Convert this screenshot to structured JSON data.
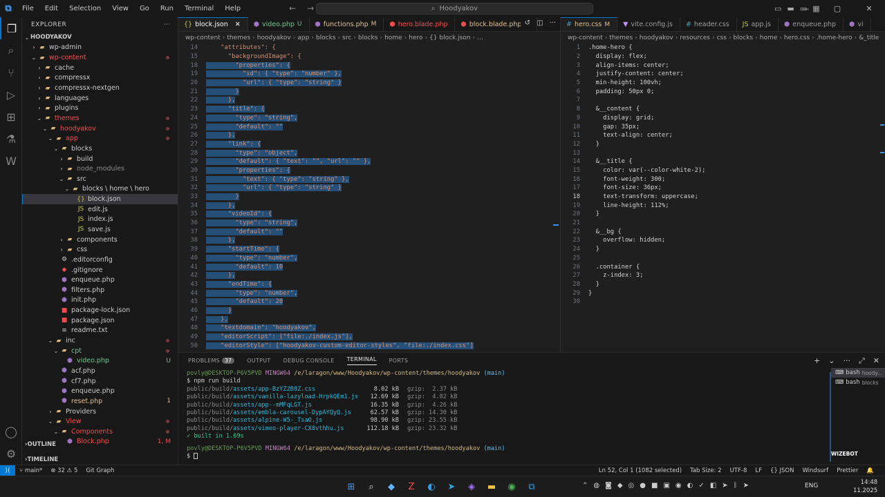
{
  "titlebar": {
    "menu": [
      "File",
      "Edit",
      "Selection",
      "View",
      "Go",
      "Run",
      "Terminal",
      "Help"
    ],
    "search": "Hoodyakov"
  },
  "sidebar": {
    "title": "EXPLORER",
    "root": "HOODYAKOV",
    "items": [
      {
        "label": "wp-admin",
        "depth": 1,
        "kind": "folder",
        "open": false,
        "color": ""
      },
      {
        "label": "wp-content",
        "depth": 1,
        "kind": "folder",
        "open": true,
        "color": "red",
        "dot": true
      },
      {
        "label": "cache",
        "depth": 2,
        "kind": "folder",
        "open": false,
        "color": ""
      },
      {
        "label": "compressx",
        "depth": 2,
        "kind": "folder",
        "open": false,
        "color": ""
      },
      {
        "label": "compressx-nextgen",
        "depth": 2,
        "kind": "folder",
        "open": false,
        "color": ""
      },
      {
        "label": "languages",
        "depth": 2,
        "kind": "folder",
        "open": false,
        "color": ""
      },
      {
        "label": "plugins",
        "depth": 2,
        "kind": "folder",
        "open": false,
        "color": ""
      },
      {
        "label": "themes",
        "depth": 2,
        "kind": "folder",
        "open": true,
        "color": "red",
        "dot": true
      },
      {
        "label": "hoodyakov",
        "depth": 3,
        "kind": "folder",
        "open": true,
        "color": "red",
        "dot": true
      },
      {
        "label": "app",
        "depth": 4,
        "kind": "folder",
        "open": true,
        "color": "red",
        "dot": true
      },
      {
        "label": "blocks",
        "depth": 5,
        "kind": "folder",
        "open": true,
        "color": "",
        "dot": false
      },
      {
        "label": "build",
        "depth": 6,
        "kind": "folder",
        "open": false,
        "color": ""
      },
      {
        "label": "node_modules",
        "depth": 6,
        "kind": "folder",
        "open": false,
        "color": "dim"
      },
      {
        "label": "src",
        "depth": 6,
        "kind": "folder",
        "open": true,
        "color": ""
      },
      {
        "label": "blocks \\ home \\ hero",
        "depth": 7,
        "kind": "folder",
        "open": true,
        "color": ""
      },
      {
        "label": "block.json",
        "depth": 8,
        "kind": "json",
        "color": "",
        "selected": true
      },
      {
        "label": "edit.js",
        "depth": 8,
        "kind": "js",
        "color": ""
      },
      {
        "label": "index.js",
        "depth": 8,
        "kind": "js",
        "color": ""
      },
      {
        "label": "save.js",
        "depth": 8,
        "kind": "js",
        "color": ""
      },
      {
        "label": "components",
        "depth": 6,
        "kind": "folder",
        "open": false,
        "color": ""
      },
      {
        "label": "css",
        "depth": 6,
        "kind": "folder",
        "open": false,
        "color": ""
      },
      {
        "label": ".editorconfig",
        "depth": 5,
        "kind": "cfg",
        "color": ""
      },
      {
        "label": ".gitignore",
        "depth": 5,
        "kind": "git",
        "color": ""
      },
      {
        "label": "enqueue.php",
        "depth": 5,
        "kind": "php",
        "color": ""
      },
      {
        "label": "filters.php",
        "depth": 5,
        "kind": "php",
        "color": ""
      },
      {
        "label": "init.php",
        "depth": 5,
        "kind": "php",
        "color": ""
      },
      {
        "label": "package-lock.json",
        "depth": 5,
        "kind": "npm",
        "color": ""
      },
      {
        "label": "package.json",
        "depth": 5,
        "kind": "npm",
        "color": ""
      },
      {
        "label": "readme.txt",
        "depth": 5,
        "kind": "txt",
        "color": ""
      },
      {
        "label": "inc",
        "depth": 4,
        "kind": "folder",
        "open": true,
        "color": "",
        "dot": true
      },
      {
        "label": "cpt",
        "depth": 5,
        "kind": "folder",
        "open": true,
        "color": "green",
        "dot": true
      },
      {
        "label": "video.php",
        "depth": 6,
        "kind": "php",
        "color": "green",
        "badge": "U"
      },
      {
        "label": "acf.php",
        "depth": 5,
        "kind": "php",
        "color": ""
      },
      {
        "label": "cf7.php",
        "depth": 5,
        "kind": "php",
        "color": ""
      },
      {
        "label": "enqueue.php",
        "depth": 5,
        "kind": "php",
        "color": ""
      },
      {
        "label": "reset.php",
        "depth": 5,
        "kind": "php",
        "color": "orange",
        "badge": "1"
      },
      {
        "label": "Providers",
        "depth": 4,
        "kind": "folder",
        "open": false,
        "color": ""
      },
      {
        "label": "View",
        "depth": 4,
        "kind": "folder",
        "open": true,
        "color": "red",
        "dot": true
      },
      {
        "label": "Components",
        "depth": 5,
        "kind": "folder",
        "open": true,
        "color": "red",
        "dot": true
      },
      {
        "label": "Block.php",
        "depth": 6,
        "kind": "php",
        "color": "red",
        "badge": "1, M"
      }
    ],
    "outline": "OUTLINE",
    "timeline": "TIMELINE"
  },
  "left_editor": {
    "tabs": [
      {
        "label": "block.json",
        "status": "",
        "active": true
      },
      {
        "label": "video.php",
        "status": "U",
        "active": false
      },
      {
        "label": "functions.php",
        "status": "M",
        "active": false
      },
      {
        "label": "hero.blade.php",
        "status": "",
        "active": false
      },
      {
        "label": "block.blade.php",
        "status": "M",
        "active": false
      }
    ],
    "breadcrumb": [
      "wp-content",
      "themes",
      "hoodyakov",
      "app",
      "blocks",
      "src",
      "blocks",
      "home",
      "hero",
      "{} block.json",
      "..."
    ],
    "lines": [
      {
        "n": "14",
        "t": "    \"attributes\": {"
      },
      {
        "n": "15",
        "t": "      \"backgroundImage\": {"
      },
      {
        "n": "18",
        "t": "        \"properties\": {"
      },
      {
        "n": "19",
        "t": "          \"id\": { \"type\": \"number\" },"
      },
      {
        "n": "20",
        "t": "          \"url\": { \"type\": \"string\" }"
      },
      {
        "n": "21",
        "t": "        }"
      },
      {
        "n": "22",
        "t": "      },"
      },
      {
        "n": "23",
        "t": "      \"title\": {"
      },
      {
        "n": "24",
        "t": "        \"type\": \"string\","
      },
      {
        "n": "25",
        "t": "        \"default\": \"\""
      },
      {
        "n": "26",
        "t": "      },"
      },
      {
        "n": "27",
        "t": "      \"link\": {"
      },
      {
        "n": "28",
        "t": "        \"type\": \"object\","
      },
      {
        "n": "29",
        "t": "        \"default\": { \"text\": \"\", \"url\": \"\" },"
      },
      {
        "n": "30",
        "t": "        \"properties\": {"
      },
      {
        "n": "31",
        "t": "          \"text\": { \"type\": \"string\" },"
      },
      {
        "n": "32",
        "t": "          \"url\": { \"type\": \"string\" }"
      },
      {
        "n": "33",
        "t": "        }"
      },
      {
        "n": "34",
        "t": "      },"
      },
      {
        "n": "35",
        "t": "      \"videoId\": {"
      },
      {
        "n": "36",
        "t": "        \"type\": \"string\","
      },
      {
        "n": "37",
        "t": "        \"default\": \"\""
      },
      {
        "n": "38",
        "t": "      },"
      },
      {
        "n": "39",
        "t": "      \"startTime\": {"
      },
      {
        "n": "40",
        "t": "        \"type\": \"number\","
      },
      {
        "n": "41",
        "t": "        \"default\": 10"
      },
      {
        "n": "42",
        "t": "      },"
      },
      {
        "n": "43",
        "t": "      \"endTime\": {"
      },
      {
        "n": "44",
        "t": "        \"type\": \"number\","
      },
      {
        "n": "45",
        "t": "        \"default\": 20"
      },
      {
        "n": "46",
        "t": "      }"
      },
      {
        "n": "47",
        "t": "    },"
      },
      {
        "n": "48",
        "t": "    \"textdomain\": \"hoodyakov\","
      },
      {
        "n": "49",
        "t": "    \"editorScript\": [\"file:./index.js\"],"
      },
      {
        "n": "50",
        "t": "    \"editorStyle\": [\"hoodyakov-custom-editor-styles\", \"file:./index.css\"]"
      }
    ]
  },
  "right_editor": {
    "tabs": [
      {
        "label": "hero.css",
        "status": "M",
        "active": true
      },
      {
        "label": "vite.config.js",
        "status": "",
        "active": false
      },
      {
        "label": "header.css",
        "status": "",
        "active": false
      },
      {
        "label": "app.js",
        "status": "",
        "active": false
      },
      {
        "label": "enqueue.php",
        "status": "",
        "active": false
      },
      {
        "label": "vi",
        "status": "",
        "active": false
      }
    ],
    "breadcrumb": [
      "wp-content",
      "themes",
      "hoodyakov",
      "resources",
      "css",
      "blocks",
      "home",
      "hero.css",
      ".home-hero",
      "&_title"
    ],
    "lines": [
      {
        "n": "1",
        "t": ".home-hero {"
      },
      {
        "n": "2",
        "t": "  display: flex;"
      },
      {
        "n": "3",
        "t": "  align-items: center;"
      },
      {
        "n": "4",
        "t": "  justify-content: center;"
      },
      {
        "n": "5",
        "t": "  min-height: 100vh;"
      },
      {
        "n": "6",
        "t": "  padding: 50px 0;"
      },
      {
        "n": "7",
        "t": ""
      },
      {
        "n": "8",
        "t": "  &__content {"
      },
      {
        "n": "9",
        "t": "    display: grid;"
      },
      {
        "n": "10",
        "t": "    gap: 35px;"
      },
      {
        "n": "11",
        "t": "    text-align: center;"
      },
      {
        "n": "12",
        "t": "  }"
      },
      {
        "n": "13",
        "t": ""
      },
      {
        "n": "14",
        "t": "  &__title {"
      },
      {
        "n": "15",
        "t": "    color: var(--color-white-2);"
      },
      {
        "n": "16",
        "t": "    font-weight: 300;"
      },
      {
        "n": "17",
        "t": "    font-size: 36px;"
      },
      {
        "n": "18",
        "t": "    text-transform: uppercase;"
      },
      {
        "n": "19",
        "t": "    line-height: 112%;"
      },
      {
        "n": "20",
        "t": "  }"
      },
      {
        "n": "21",
        "t": ""
      },
      {
        "n": "22",
        "t": "  &__bg {"
      },
      {
        "n": "23",
        "t": "    overflow: hidden;"
      },
      {
        "n": "24",
        "t": "  }"
      },
      {
        "n": "25",
        "t": ""
      },
      {
        "n": "26",
        "t": "  .container {"
      },
      {
        "n": "27",
        "t": "    z-index: 3;"
      },
      {
        "n": "28",
        "t": "  }"
      },
      {
        "n": "29",
        "t": "}"
      },
      {
        "n": "30",
        "t": ""
      }
    ],
    "current_line": "18"
  },
  "panel": {
    "tabs": [
      {
        "label": "PROBLEMS",
        "count": "37"
      },
      {
        "label": "OUTPUT"
      },
      {
        "label": "DEBUG CONSOLE"
      },
      {
        "label": "TERMINAL",
        "active": true
      },
      {
        "label": "PORTS"
      }
    ],
    "prompt_user": "povly@DESKTOP-P6V5PVD",
    "prompt_shell": "MINGW64",
    "prompt_path": "/e/laragon/www/Hoodyakov/wp-content/themes/hoodyakov",
    "prompt_branch": "(main)",
    "command": "$ npm run build",
    "build_rows": [
      {
        "dir": "public/build/",
        "file": "assets/app-BzYZ2B8Z.css",
        "size": "8.02 kB",
        "gzip": "gzip:  2.37 kB"
      },
      {
        "dir": "public/build/",
        "file": "assets/vanilla-lazyload-HrpkQEm1.js",
        "size": "12.69 kB",
        "gzip": "gzip:  4.02 kB"
      },
      {
        "dir": "public/build/",
        "file": "assets/app--mMFqLGT.js",
        "size": "16.35 kB",
        "gzip": "gzip:  4.26 kB"
      },
      {
        "dir": "public/build/",
        "file": "assets/embla-carousel-DypAYQyQ.js",
        "size": "62.57 kB",
        "gzip": "gzip: 14.30 kB"
      },
      {
        "dir": "public/build/",
        "file": "assets/alpine-W5-_TsaO.js",
        "size": "98.90 kB",
        "gzip": "gzip: 23.55 kB"
      },
      {
        "dir": "public/build/",
        "file": "assets/vimeo-player-CX0vthhu.js",
        "size": "112.18 kB",
        "gzip": "gzip: 23.32 kB"
      }
    ],
    "built": "✓ built in 1.69s",
    "prompt2": "$",
    "terminals": [
      {
        "label": "bash",
        "sub": "hoody...",
        "active": true
      },
      {
        "label": "bash",
        "sub": "blocks",
        "active": false
      }
    ]
  },
  "statusbar": {
    "branch": "main*",
    "errors": "⊗ 32 ⚠ 5",
    "graph": "Git Graph",
    "cursor": "Ln 52, Col 1 (1082 selected)",
    "tabsize": "Tab Size: 2",
    "encoding": "UTF-8",
    "eol": "LF",
    "lang": "{} JSON",
    "windsurf": "Windsurf",
    "prettier": "Prettier",
    "wizebot": "WIZEBOT"
  },
  "taskbar": {
    "lang": "ENG",
    "time": "14:48",
    "date": "11.2025"
  }
}
